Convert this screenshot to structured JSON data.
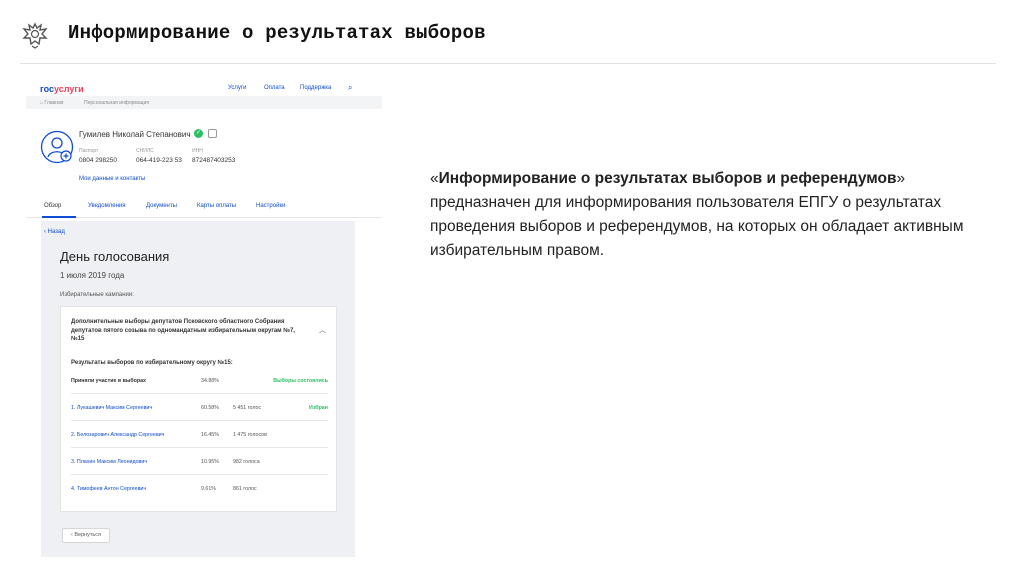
{
  "slide": {
    "title": "Информирование о результатах выборов",
    "emblem_icon": "russian-eagle-emblem"
  },
  "screenshot": {
    "logo_part1": "гос",
    "logo_part2": "услуги",
    "nav": [
      "Услуги",
      "Оплата",
      "Поддержка"
    ],
    "search_icon": "search-icon",
    "breadcrumbs": [
      "Главная",
      "Персональная информация"
    ],
    "user": {
      "name": "Гумилев Николай Степанович",
      "verified_mark": "✓",
      "docs": [
        {
          "label": "Паспорт",
          "value": "0804 298250"
        },
        {
          "label": "СНИЛС",
          "value": "064-419-223 53"
        },
        {
          "label": "ИНН",
          "value": "872487403253"
        }
      ],
      "my_data_link": "Мои данные и контакты"
    },
    "tabs": [
      "Обзор",
      "Уведомления",
      "Документы",
      "Карты оплаты",
      "Настройки"
    ],
    "back_link": "‹ Назад",
    "voting_day_title": "День голосования",
    "voting_date": "1 июля 2019 года",
    "campaigns_label": "Избирательные кампании:",
    "campaign": {
      "title": "Дополнительные выборы депутатов Псковского областного Собрания депутатов пятого созыва по одномандатным избирательным округам №7, №15",
      "collapse_icon": "chevron-up-icon",
      "results_title": "Результаты выборов по избирательному округу №15:",
      "turnout": {
        "label": "Приняли участие в выборах",
        "pct": "34.88%",
        "status": "Выборы состоялись"
      },
      "candidates": [
        {
          "name": "1. Лукашевич Максим Сергеевич",
          "pct": "60.58%",
          "votes": "5 451 голос",
          "status": "Избран"
        },
        {
          "name": "2. Белозарович Александр Сергеевич",
          "pct": "16.45%",
          "votes": "1 475 голосов",
          "status": ""
        },
        {
          "name": "3. Плахин Максим Леонидович",
          "pct": "10.95%",
          "votes": "982 голоса",
          "status": ""
        },
        {
          "name": "4. Тимофеев Антон Сергеевич",
          "pct": "9.61%",
          "votes": "861 голос",
          "status": ""
        }
      ]
    },
    "return_button": "Вернуться"
  },
  "description": {
    "open_quote": "«",
    "bold_title": "Информирование о результатах выборов и референдумов",
    "close_quote": "»",
    "text": " предназначен для информирования пользователя ЕПГУ о результатах проведения выборов и референдумов, на которых он обладает активным избирательным правом."
  },
  "colors": {
    "accent": "#0d4cd3",
    "brand_red": "#ee3f58",
    "success": "#2dbf63"
  }
}
